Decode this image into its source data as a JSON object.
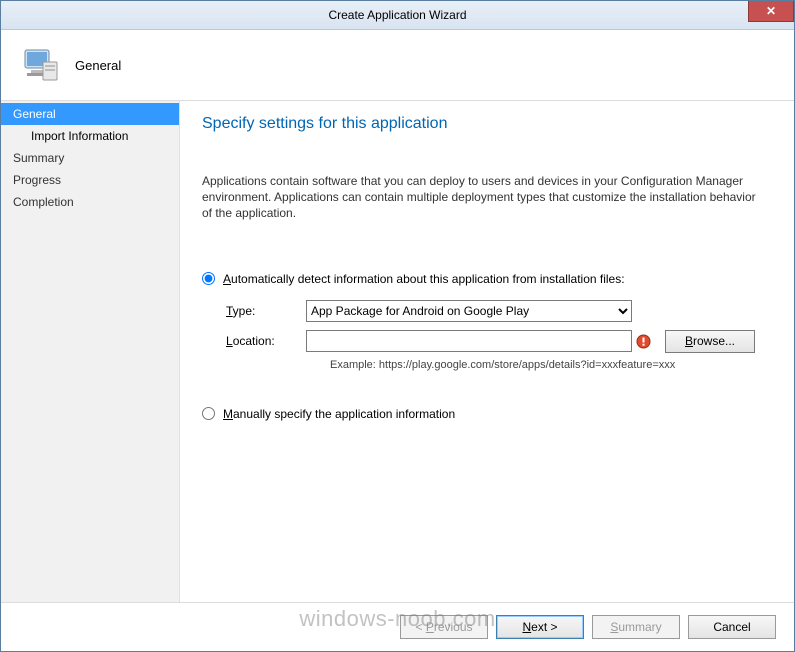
{
  "titlebar": {
    "title": "Create Application Wizard"
  },
  "header": {
    "label": "General"
  },
  "sidebar": {
    "items": [
      {
        "label": "General",
        "selected": true,
        "sub": false
      },
      {
        "label": "Import Information",
        "selected": false,
        "sub": true
      },
      {
        "label": "Summary",
        "selected": false,
        "sub": false
      },
      {
        "label": "Progress",
        "selected": false,
        "sub": false
      },
      {
        "label": "Completion",
        "selected": false,
        "sub": false
      }
    ]
  },
  "content": {
    "heading": "Specify settings for this application",
    "description": "Applications contain software that you can deploy to users and devices in your Configuration Manager environment. Applications can contain multiple deployment types that customize the installation behavior of the application.",
    "option_auto": "Automatically detect information about this application from installation files:",
    "option_manual": "Manually specify the application information",
    "type_label": "Type:",
    "type_value": "App Package for Android on Google Play",
    "location_label": "Location:",
    "location_value": "",
    "location_example": "Example: https://play.google.com/store/apps/details?id=xxxfeature=xxx",
    "browse_label": "Browse..."
  },
  "footer": {
    "previous": "< Previous",
    "next": "Next >",
    "summary": "Summary",
    "cancel": "Cancel"
  },
  "watermark": "windows-noob.com"
}
